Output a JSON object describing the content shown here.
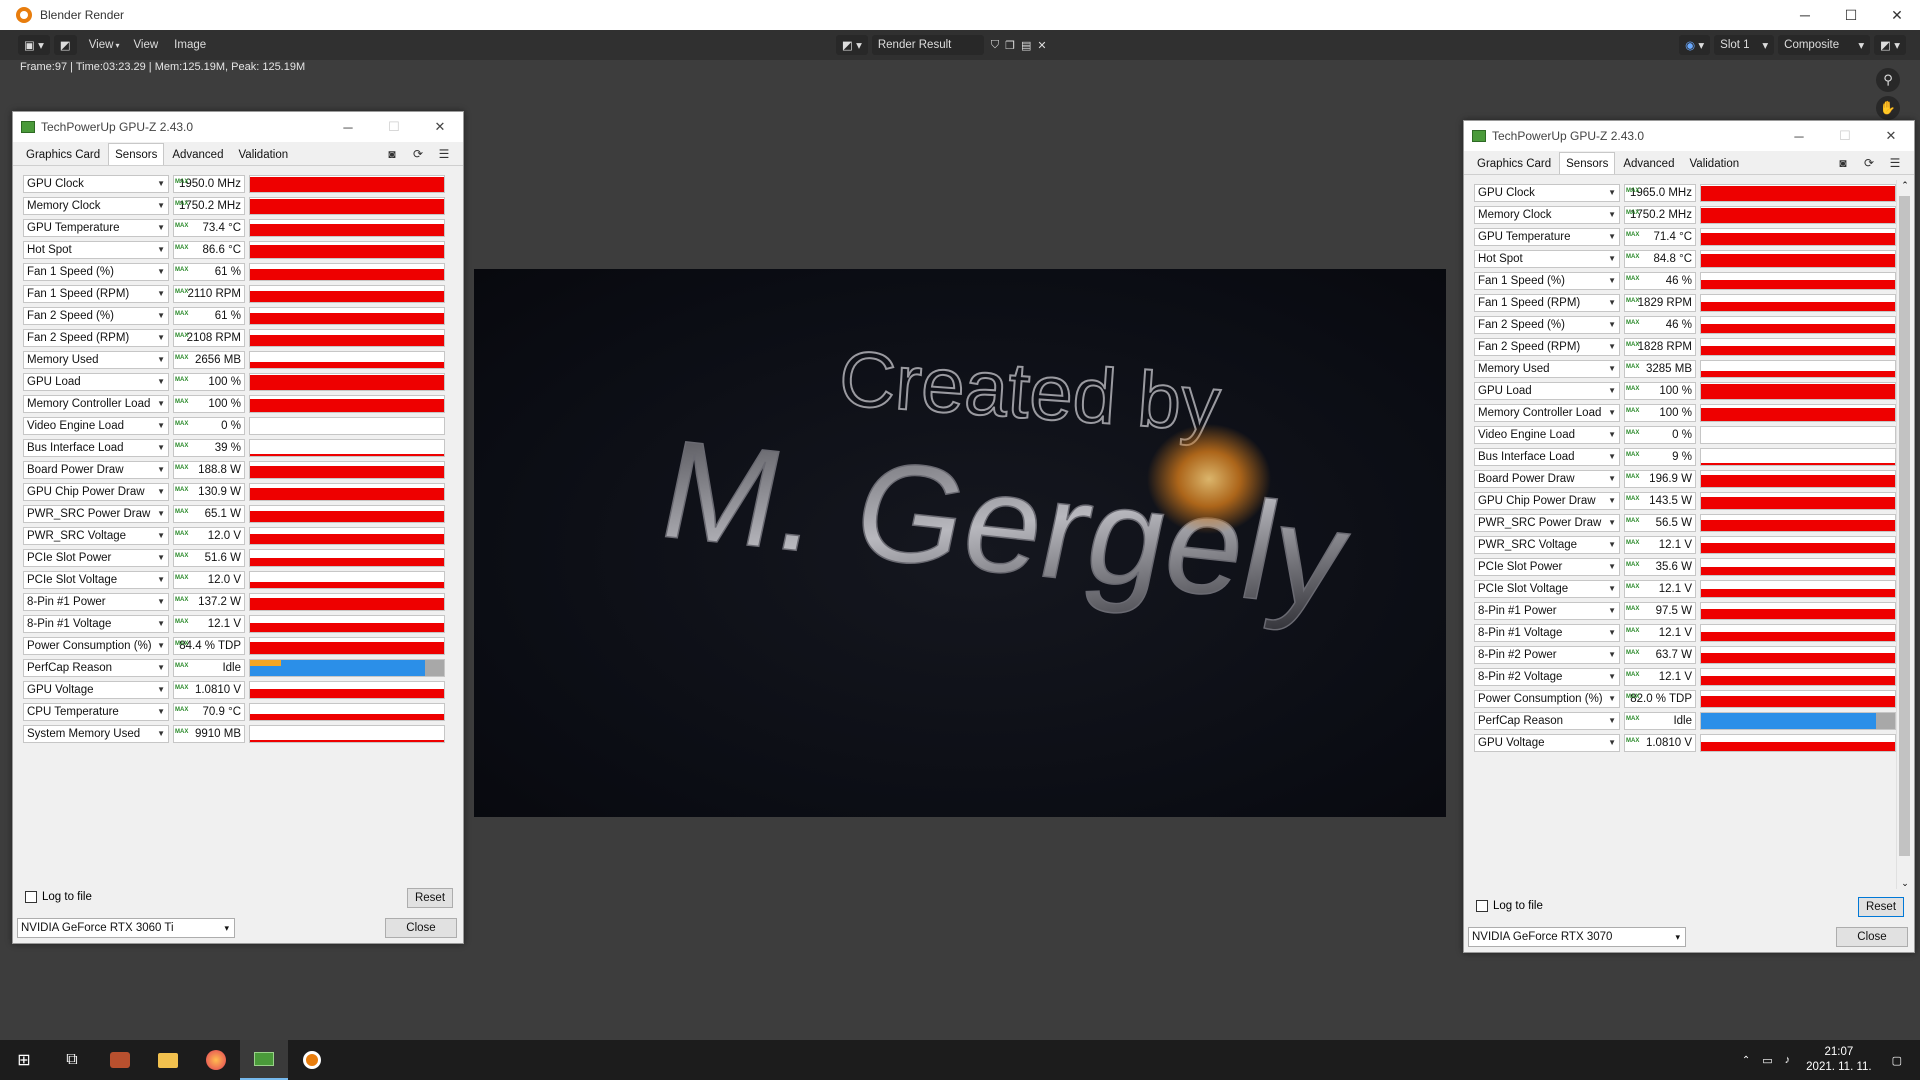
{
  "blender": {
    "window_title": "Blender Render",
    "menu": [
      "View",
      "Image"
    ],
    "image_name": "Render Result",
    "slot": "Slot 1",
    "layer": "Composite",
    "status": "Frame:97 | Time:03:23.29 | Mem:125.19M, Peak: 125.19M",
    "render_text_line1": "Created by",
    "render_text_line2": "M. Gergely"
  },
  "taskbar": {
    "time": "21:07",
    "date": "2021. 11. 11."
  },
  "colors": {
    "graph_red": "#ee0000",
    "perfcap_blue": "#2b8fe8",
    "perfcap_orange": "#f5a623",
    "max_green": "#2b8a2b"
  },
  "gpuz_left": {
    "title": "TechPowerUp GPU-Z 2.43.0",
    "tabs": [
      "Graphics Card",
      "Sensors",
      "Advanced",
      "Validation"
    ],
    "log_label": "Log to file",
    "reset_label": "Reset",
    "gpu_select": "NVIDIA GeForce RTX 3060 Ti",
    "close_label": "Close",
    "max_label": "MAX",
    "sensors": [
      {
        "name": "GPU Clock",
        "value": "1950.0 MHz",
        "level": 0.95
      },
      {
        "name": "Memory Clock",
        "value": "1750.2 MHz",
        "level": 0.95
      },
      {
        "name": "GPU Temperature",
        "value": "73.4 °C",
        "level": 0.75
      },
      {
        "name": "Hot Spot",
        "value": "86.6 °C",
        "level": 0.8
      },
      {
        "name": "Fan 1 Speed (%)",
        "value": "61 %",
        "level": 0.7
      },
      {
        "name": "Fan 1 Speed (RPM)",
        "value": "2110 RPM",
        "level": 0.7
      },
      {
        "name": "Fan 2 Speed (%)",
        "value": "61 %",
        "level": 0.7
      },
      {
        "name": "Fan 2 Speed (RPM)",
        "value": "2108 RPM",
        "level": 0.7
      },
      {
        "name": "Memory Used",
        "value": "2656 MB",
        "level": 0.35
      },
      {
        "name": "GPU Load",
        "value": "100 %",
        "level": 0.95
      },
      {
        "name": "Memory Controller Load",
        "value": "100 %",
        "level": 0.8
      },
      {
        "name": "Video Engine Load",
        "value": "0 %",
        "level": 0.0
      },
      {
        "name": "Bus Interface Load",
        "value": "39 %",
        "level": 0.1
      },
      {
        "name": "Board Power Draw",
        "value": "188.8 W",
        "level": 0.75
      },
      {
        "name": "GPU Chip Power Draw",
        "value": "130.9 W",
        "level": 0.75
      },
      {
        "name": "PWR_SRC Power Draw",
        "value": "65.1 W",
        "level": 0.7
      },
      {
        "name": "PWR_SRC Voltage",
        "value": "12.0 V",
        "level": 0.6
      },
      {
        "name": "PCIe Slot Power",
        "value": "51.6 W",
        "level": 0.5
      },
      {
        "name": "PCIe Slot Voltage",
        "value": "12.0 V",
        "level": 0.4
      },
      {
        "name": "8-Pin #1 Power",
        "value": "137.2 W",
        "level": 0.75
      },
      {
        "name": "8-Pin #1 Voltage",
        "value": "12.1 V",
        "level": 0.55
      },
      {
        "name": "Power Consumption (%)",
        "value": "84.4 % TDP",
        "level": 0.75
      },
      {
        "name": "PerfCap Reason",
        "value": "Idle",
        "level": 1.0,
        "perfcap": true
      },
      {
        "name": "GPU Voltage",
        "value": "1.0810 V",
        "level": 0.55
      },
      {
        "name": "CPU Temperature",
        "value": "70.9 °C",
        "level": 0.4
      },
      {
        "name": "System Memory Used",
        "value": "9910 MB",
        "level": 0.1
      }
    ]
  },
  "gpuz_right": {
    "title": "TechPowerUp GPU-Z 2.43.0",
    "tabs": [
      "Graphics Card",
      "Sensors",
      "Advanced",
      "Validation"
    ],
    "log_label": "Log to file",
    "reset_label": "Reset",
    "gpu_select": "NVIDIA GeForce RTX 3070",
    "close_label": "Close",
    "max_label": "MAX",
    "sensors": [
      {
        "name": "GPU Clock",
        "value": "1965.0 MHz",
        "level": 0.95
      },
      {
        "name": "Memory Clock",
        "value": "1750.2 MHz",
        "level": 0.95
      },
      {
        "name": "GPU Temperature",
        "value": "71.4 °C",
        "level": 0.75
      },
      {
        "name": "Hot Spot",
        "value": "84.8 °C",
        "level": 0.8
      },
      {
        "name": "Fan 1 Speed (%)",
        "value": "46 %",
        "level": 0.55
      },
      {
        "name": "Fan 1 Speed (RPM)",
        "value": "1829 RPM",
        "level": 0.55
      },
      {
        "name": "Fan 2 Speed (%)",
        "value": "46 %",
        "level": 0.55
      },
      {
        "name": "Fan 2 Speed (RPM)",
        "value": "1828 RPM",
        "level": 0.55
      },
      {
        "name": "Memory Used",
        "value": "3285 MB",
        "level": 0.35
      },
      {
        "name": "GPU Load",
        "value": "100 %",
        "level": 0.95
      },
      {
        "name": "Memory Controller Load",
        "value": "100 %",
        "level": 0.8
      },
      {
        "name": "Video Engine Load",
        "value": "0 %",
        "level": 0.0
      },
      {
        "name": "Bus Interface Load",
        "value": "9 %",
        "level": 0.05
      },
      {
        "name": "Board Power Draw",
        "value": "196.9 W",
        "level": 0.75
      },
      {
        "name": "GPU Chip Power Draw",
        "value": "143.5 W",
        "level": 0.75
      },
      {
        "name": "PWR_SRC Power Draw",
        "value": "56.5 W",
        "level": 0.7
      },
      {
        "name": "PWR_SRC Voltage",
        "value": "12.1 V",
        "level": 0.6
      },
      {
        "name": "PCIe Slot Power",
        "value": "35.6 W",
        "level": 0.5
      },
      {
        "name": "PCIe Slot Voltage",
        "value": "12.1 V",
        "level": 0.5
      },
      {
        "name": "8-Pin #1 Power",
        "value": "97.5 W",
        "level": 0.6
      },
      {
        "name": "8-Pin #1 Voltage",
        "value": "12.1 V",
        "level": 0.55
      },
      {
        "name": "8-Pin #2 Power",
        "value": "63.7 W",
        "level": 0.6
      },
      {
        "name": "8-Pin #2 Voltage",
        "value": "12.1 V",
        "level": 0.55
      },
      {
        "name": "Power Consumption (%)",
        "value": "82.0 % TDP",
        "level": 0.7
      },
      {
        "name": "PerfCap Reason",
        "value": "Idle",
        "level": 1.0,
        "perfcap": true
      },
      {
        "name": "GPU Voltage",
        "value": "1.0810 V",
        "level": 0.55
      }
    ]
  }
}
